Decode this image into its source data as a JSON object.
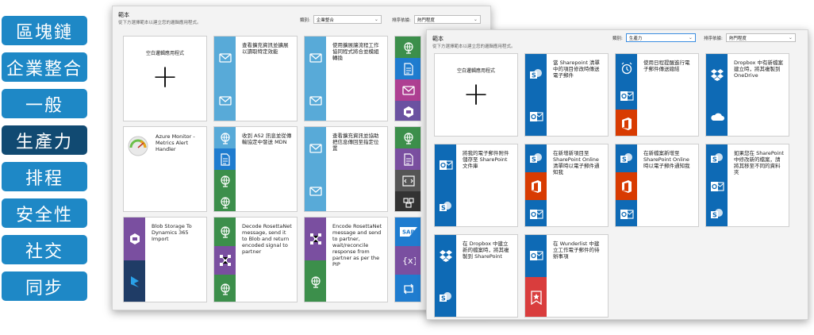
{
  "categories": [
    {
      "label": "區塊鏈",
      "active": false
    },
    {
      "label": "企業整合",
      "active": false
    },
    {
      "label": "一般",
      "active": false
    },
    {
      "label": "生產力",
      "active": true
    },
    {
      "label": "排程",
      "active": false
    },
    {
      "label": "安全性",
      "active": false
    },
    {
      "label": "社交",
      "active": false
    },
    {
      "label": "同步",
      "active": false
    }
  ],
  "windows": [
    {
      "title": "範本",
      "subtitle": "從下方選擇範本以建立您的邏輯應用程式。",
      "category_label": "類別:",
      "category_value": "企業整合",
      "sort_label": "排序依據:",
      "sort_value": "熱門程度",
      "cards": [
        {
          "type": "blank",
          "text": "空白邏輯應用程式"
        },
        {
          "type": "strip",
          "text": "查看擴充資訊並擴展以讀取特定效能",
          "icons": [
            "envelope-icon",
            "envelope-icon"
          ],
          "colors": [
            "#58aad8",
            "#58aad8"
          ]
        },
        {
          "type": "strip",
          "text": "使用擴展讓流程工作協同程式將合並模組轉換",
          "icons": [
            "envelope-icon",
            "envelope-icon"
          ],
          "colors": [
            "#58aad8",
            "#58aad8"
          ]
        },
        {
          "type": "stack",
          "icons": [
            "globe-icon",
            "document-icon",
            "envelope-icon",
            "hexagon-icon"
          ],
          "colors": [
            "#3c8f4b",
            "#1f7ccf",
            "#ae3f92",
            "#6b52a1"
          ]
        },
        {
          "type": "gauge",
          "text": "Azure Monitor - Metrics Alert Handler"
        },
        {
          "type": "strip",
          "text": "收到 AS2 訊息並從傳輸協定中發送 MDN",
          "icons": [
            "globe-icon",
            "document-icon",
            "globe-icon",
            "globe-icon"
          ],
          "colors": [
            "#58aad8",
            "#1f7ccf",
            "#3c8f4b",
            "#3c8f4b"
          ]
        },
        {
          "type": "strip",
          "text": "查看擴充資訊並協助把信息傳回至指定位置",
          "icons": [
            "envelope-icon",
            "envelope-icon"
          ],
          "colors": [
            "#58aad8",
            "#58aad8"
          ]
        },
        {
          "type": "stack",
          "icons": [
            "globe-icon",
            "document-icon",
            "code-icon",
            "branch-icon"
          ],
          "colors": [
            "#3c8f4b",
            "#7a4fa0",
            "#555555",
            "#333333"
          ]
        },
        {
          "type": "strip",
          "text": "Blob Storage To Dynamics 365 Import",
          "icons": [
            "hexagon-icon",
            "dynamics-icon"
          ],
          "colors": [
            "#7a4fa0",
            "#1f3c66"
          ]
        },
        {
          "type": "strip",
          "text": "Decode RosettaNet message, send it to Blob and return encoded signal to partner",
          "icons": [
            "globe-icon",
            "network-icon",
            "globe-icon"
          ],
          "colors": [
            "#3c8f4b",
            "#7a4fa0",
            "#3c8f4b"
          ]
        },
        {
          "type": "strip",
          "text": "Encode RosettaNet message and send to partner, wait/reconcile response from partner as per the PIP",
          "icons": [
            "network-icon",
            "globe-icon"
          ],
          "colors": [
            "#7a4fa0",
            "#3c8f4b"
          ]
        },
        {
          "type": "stack",
          "icons": [
            "sap-icon",
            "variable-icon",
            "loop-icon"
          ],
          "colors": [
            "#1f7ccf",
            "#7a4fa0",
            "#1f7ccf"
          ]
        }
      ]
    },
    {
      "title": "範本",
      "subtitle": "從下方選擇範本以建立您的邏輯應用程式。",
      "category_label": "類別:",
      "category_value": "生產力",
      "sort_label": "排序依據:",
      "sort_value": "熱門程度",
      "cards": [
        {
          "type": "blank",
          "text": "空白邏輯應用程式"
        },
        {
          "type": "strip",
          "text": "當 Sharepoint 清單中的項目修改時傳送電子郵件",
          "icons": [
            "sharepoint-icon",
            "outlook-icon"
          ],
          "colors": [
            "#0e6ab5",
            "#0e6ab5"
          ]
        },
        {
          "type": "strip",
          "text": "使用日程提醒進行電子郵件傳送總結",
          "icons": [
            "alarm-icon",
            "outlook-icon",
            "office-icon"
          ],
          "colors": [
            "#0e6ab5",
            "#0e6ab5",
            "#d83b01"
          ]
        },
        {
          "type": "strip",
          "text": "Dropbox 中有新檔案建立時，將其複製到 OneDrive",
          "icons": [
            "dropbox-icon",
            "cloud-icon"
          ],
          "colors": [
            "#0e6ab5",
            "#0e6ab5"
          ]
        },
        {
          "type": "strip",
          "text": "將我的電子郵件附件儲存至 SharePoint 文件庫",
          "icons": [
            "outlook-icon",
            "sharepoint-icon"
          ],
          "colors": [
            "#0e6ab5",
            "#0e6ab5"
          ]
        },
        {
          "type": "strip",
          "text": "在新增新項目至 SharePoint Online 清單時以電子郵件通知我",
          "icons": [
            "sharepoint-icon",
            "office-icon",
            "outlook-icon"
          ],
          "colors": [
            "#0e6ab5",
            "#d83b01",
            "#0e6ab5"
          ]
        },
        {
          "type": "strip",
          "text": "在新檔案新增至 SharePoint Online 時以電子郵件通知我",
          "icons": [
            "sharepoint-icon",
            "office-icon",
            "outlook-icon"
          ],
          "colors": [
            "#0e6ab5",
            "#d83b01",
            "#0e6ab5"
          ]
        },
        {
          "type": "strip",
          "text": "如果您在 SharePoint 中修改新的檔案，請將其移至不同的資料夾",
          "icons": [
            "sharepoint-icon",
            "outlook-icon",
            "sharepoint-icon"
          ],
          "colors": [
            "#0e6ab5",
            "#0e6ab5",
            "#0e6ab5"
          ]
        },
        {
          "type": "strip",
          "text": "在 Dropbox 中建立新的檔案時，將其複製到 SharePoint",
          "icons": [
            "dropbox-icon",
            "sharepoint-icon"
          ],
          "colors": [
            "#0e6ab5",
            "#0e6ab5"
          ]
        },
        {
          "type": "strip",
          "text": "在 Wunderlist 中建立工作電子郵件的待辦事項",
          "icons": [
            "outlook-icon",
            "wunderlist-icon"
          ],
          "colors": [
            "#0e6ab5",
            "#d93d3d"
          ]
        }
      ]
    }
  ]
}
